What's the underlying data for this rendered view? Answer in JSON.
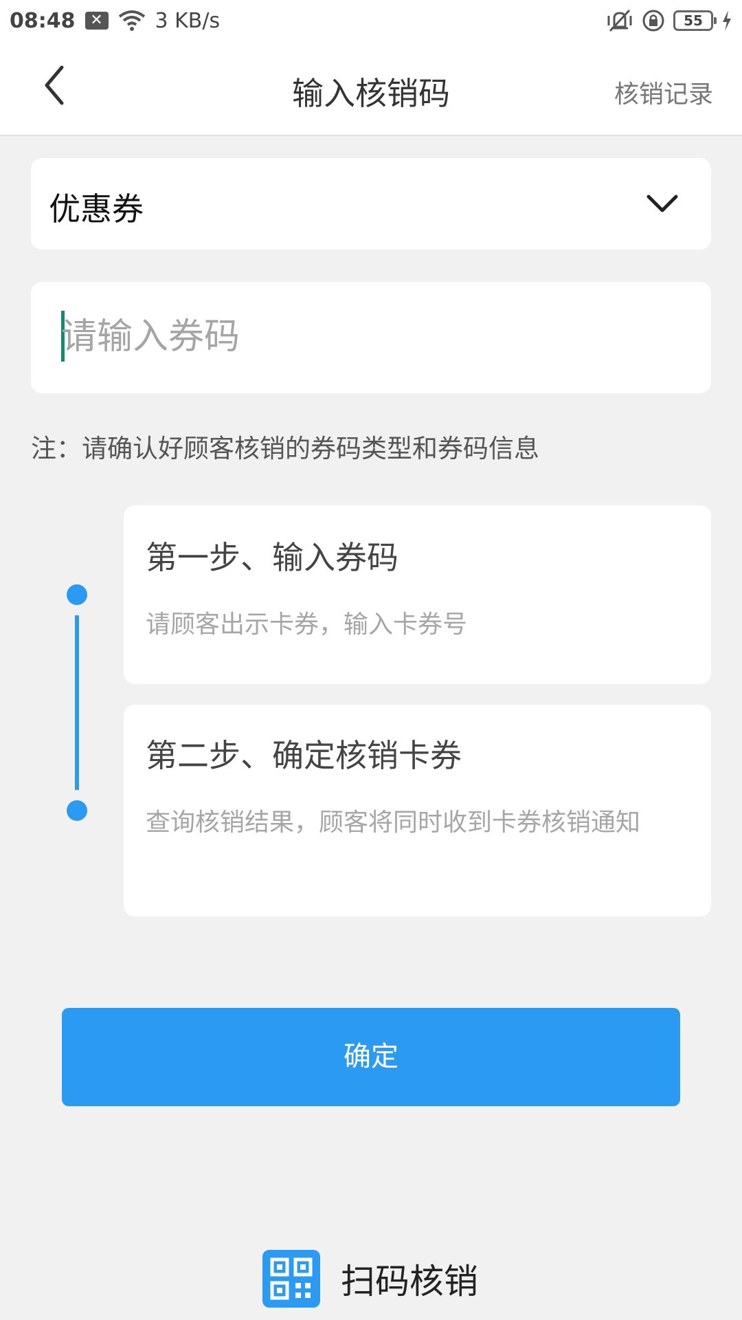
{
  "status_bar": {
    "time": "08:48",
    "notif_icon": "close-box-icon",
    "speed": "3 KB/s",
    "battery": "55"
  },
  "header": {
    "title": "输入核销码",
    "action_label": "核销记录"
  },
  "type_select": {
    "value": "优惠券"
  },
  "code_input": {
    "placeholder": "请输入券码",
    "value": ""
  },
  "note": "注：请确认好顾客核销的券码类型和券码信息",
  "steps": [
    {
      "title": "第一步、输入券码",
      "desc": "请顾客出示卡券，输入卡券号"
    },
    {
      "title": "第二步、确定核销卡券",
      "desc": "查询核销结果，顾客将同时收到卡券核销通知"
    }
  ],
  "confirm_label": "确定",
  "scan_label": "扫码核销",
  "colors": {
    "accent": "#2b9af3",
    "caret": "#138a72",
    "background": "#f1f1f1"
  }
}
